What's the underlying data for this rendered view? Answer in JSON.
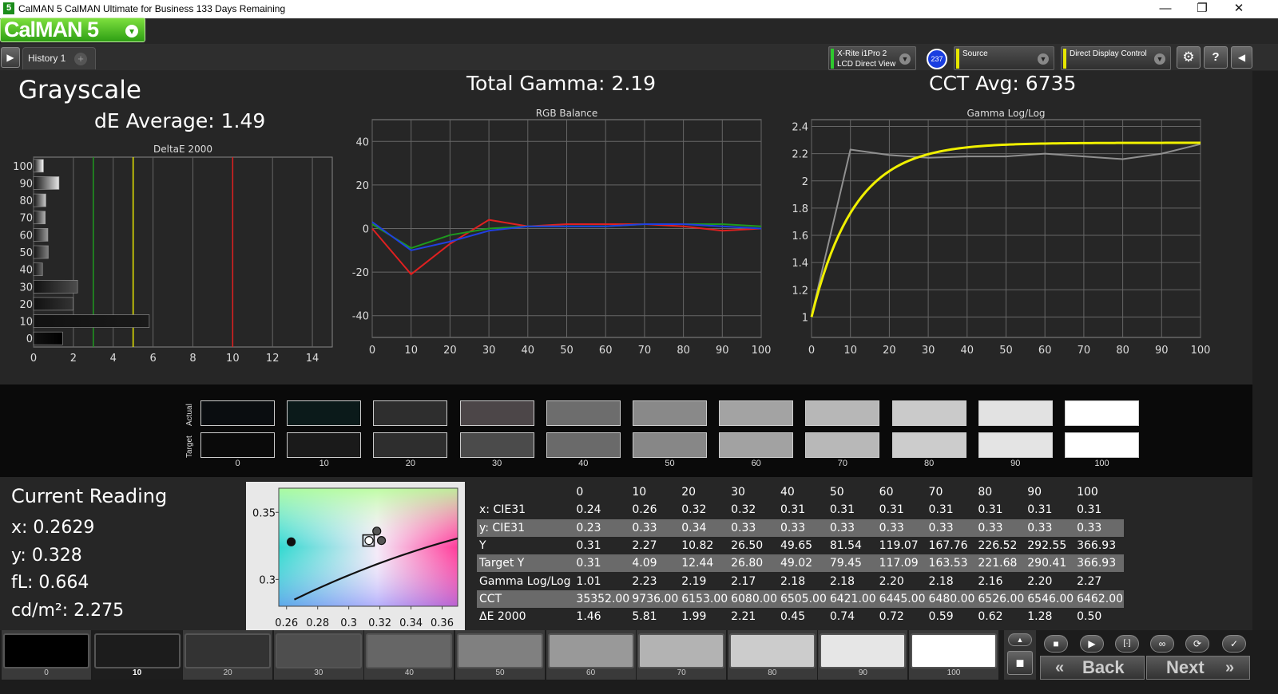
{
  "window": {
    "title": "CalMAN 5 CalMAN Ultimate for Business 133 Days Remaining",
    "min": "—",
    "max": "❐",
    "close": "✕",
    "app_icon": "5"
  },
  "logo": {
    "text": "CalMAN 5",
    "menu_icon": "▾"
  },
  "tabs": {
    "history": "History 1",
    "add": "+",
    "play_icon": "▶"
  },
  "devices": {
    "meter": {
      "line1": "X-Rite i1Pro 2",
      "line2": "LCD Direct View",
      "badge": "237"
    },
    "source": {
      "label": "Source"
    },
    "display": {
      "label": "Direct Display Control"
    }
  },
  "toolbar_right": {
    "settings_icon": "⚙",
    "help_icon": "?",
    "collapse_icon": "◀"
  },
  "page": {
    "title": "Grayscale",
    "de_avg": "dE Average: 1.49",
    "total_gamma": "Total Gamma: 2.19",
    "cct_avg": "CCT Avg: 6735"
  },
  "chart_data": [
    {
      "type": "bar",
      "title": "DeltaE 2000",
      "categories": [
        "0",
        "10",
        "20",
        "30",
        "40",
        "50",
        "60",
        "70",
        "80",
        "90",
        "100"
      ],
      "values": [
        1.46,
        5.81,
        1.99,
        2.21,
        0.45,
        0.74,
        0.72,
        0.59,
        0.62,
        1.28,
        0.5
      ],
      "xlim": [
        0,
        15
      ],
      "xticks": [
        0,
        2,
        4,
        6,
        8,
        10,
        12,
        14
      ],
      "thresholds": [
        {
          "value": 3,
          "color": "#1e9a1e"
        },
        {
          "value": 5,
          "color": "#e6e600"
        },
        {
          "value": 10,
          "color": "#e02020"
        }
      ]
    },
    {
      "type": "line",
      "title": "RGB Balance",
      "x": [
        0,
        10,
        20,
        30,
        40,
        50,
        60,
        70,
        80,
        90,
        100
      ],
      "xlim": [
        0,
        100
      ],
      "ylim": [
        -50,
        50
      ],
      "yticks": [
        -40,
        -20,
        0,
        20,
        40
      ],
      "series": [
        {
          "color": "#e02020",
          "values": [
            0,
            -21,
            -7,
            4,
            1,
            2,
            2,
            2,
            1,
            -1,
            0
          ]
        },
        {
          "color": "#1e9a1e",
          "values": [
            2,
            -9,
            -3,
            0,
            1,
            1,
            1,
            2,
            2,
            2,
            1
          ]
        },
        {
          "color": "#2040e0",
          "values": [
            3,
            -10,
            -6,
            -1,
            1,
            1,
            1,
            2,
            2,
            1,
            0
          ]
        }
      ]
    },
    {
      "type": "line",
      "title": "Gamma Log/Log",
      "x": [
        0,
        10,
        20,
        30,
        40,
        50,
        60,
        70,
        80,
        90,
        100
      ],
      "xlim": [
        0,
        100
      ],
      "ylim": [
        0.85,
        2.45
      ],
      "yticks": [
        1,
        1.2,
        1.4,
        1.6,
        1.8,
        2,
        2.2,
        2.4
      ],
      "series": [
        {
          "color": "#909090",
          "values": [
            1.01,
            2.23,
            2.19,
            2.17,
            2.18,
            2.18,
            2.2,
            2.18,
            2.16,
            2.2,
            2.27
          ]
        },
        {
          "color": "#f0f000",
          "target_gamma": 2.2,
          "values": [
            1.0,
            1.95,
            2.1,
            2.16,
            2.2,
            2.23,
            2.25,
            2.26,
            2.27,
            2.275,
            2.28
          ]
        }
      ]
    },
    {
      "type": "scatter",
      "title": "CIE xy",
      "xlim": [
        0.255,
        0.37
      ],
      "ylim": [
        0.28,
        0.368
      ],
      "xticks": [
        0.26,
        0.28,
        0.3,
        0.32,
        0.34,
        0.36
      ],
      "yticks": [
        0.3,
        0.35
      ],
      "points": [
        [
          0.263,
          0.328
        ],
        [
          0.318,
          0.336
        ],
        [
          0.321,
          0.329
        ],
        [
          0.313,
          0.329
        ]
      ],
      "target": [
        0.3127,
        0.329
      ]
    }
  ],
  "swatches": {
    "actual_label": "Actual",
    "target_label": "Target",
    "labels": [
      "0",
      "10",
      "20",
      "30",
      "40",
      "50",
      "60",
      "70",
      "80",
      "90",
      "100"
    ],
    "actual": [
      "#0a0d10",
      "#0b1a1a",
      "#2e2e2e",
      "#4c4648",
      "#6d6d6d",
      "#898989",
      "#a3a3a3",
      "#b7b7b7",
      "#cacaca",
      "#e2e2e2",
      "#ffffff"
    ],
    "target": [
      "#0a0a0a",
      "#1a1a1a",
      "#2e2e2e",
      "#4b4b4b",
      "#6a6a6a",
      "#878787",
      "#a2a2a2",
      "#b8b8b8",
      "#cccccc",
      "#e4e4e4",
      "#ffffff"
    ]
  },
  "current": {
    "title": "Current Reading",
    "x": "x: 0.2629",
    "y": "y: 0.328",
    "fl": "fL: 0.664",
    "cdm2": "cd/m²: 2.275"
  },
  "table": {
    "headers": [
      "",
      "0",
      "10",
      "20",
      "30",
      "40",
      "50",
      "60",
      "70",
      "80",
      "90",
      "100"
    ],
    "rows": [
      [
        "x: CIE31",
        "0.24",
        "0.26",
        "0.32",
        "0.32",
        "0.31",
        "0.31",
        "0.31",
        "0.31",
        "0.31",
        "0.31",
        "0.31"
      ],
      [
        "y: CIE31",
        "0.23",
        "0.33",
        "0.34",
        "0.33",
        "0.33",
        "0.33",
        "0.33",
        "0.33",
        "0.33",
        "0.33",
        "0.33"
      ],
      [
        "Y",
        "0.31",
        "2.27",
        "10.82",
        "26.50",
        "49.65",
        "81.54",
        "119.07",
        "167.76",
        "226.52",
        "292.55",
        "366.93"
      ],
      [
        "Target Y",
        "0.31",
        "4.09",
        "12.44",
        "26.80",
        "49.02",
        "79.45",
        "117.09",
        "163.53",
        "221.68",
        "290.41",
        "366.93"
      ],
      [
        "Gamma Log/Log",
        "1.01",
        "2.23",
        "2.19",
        "2.17",
        "2.18",
        "2.18",
        "2.20",
        "2.18",
        "2.16",
        "2.20",
        "2.27"
      ],
      [
        "CCT",
        "35352.00",
        "9736.00",
        "6153.00",
        "6080.00",
        "6505.00",
        "6421.00",
        "6445.00",
        "6480.00",
        "6526.00",
        "6546.00",
        "6462.00"
      ],
      [
        "ΔE 2000",
        "1.46",
        "5.81",
        "1.99",
        "2.21",
        "0.45",
        "0.74",
        "0.72",
        "0.59",
        "0.62",
        "1.28",
        "0.50"
      ]
    ]
  },
  "footer": {
    "labels": [
      "0",
      "10",
      "20",
      "30",
      "40",
      "50",
      "60",
      "70",
      "80",
      "90",
      "100"
    ],
    "colors": [
      "#000000",
      "#1c1c1c",
      "#333333",
      "#4e4e4e",
      "#666666",
      "#808080",
      "#999999",
      "#b3b3b3",
      "#cccccc",
      "#e6e6e6",
      "#ffffff"
    ],
    "back": "Back",
    "next": "Next",
    "back_icon": "«",
    "next_icon": "»"
  },
  "controls": {
    "stop": "■",
    "play": "▶",
    "loop": "∞",
    "sync": "⟳",
    "check": "✓",
    "measure_icon": "[·]",
    "up": "▲",
    "square": "■"
  }
}
